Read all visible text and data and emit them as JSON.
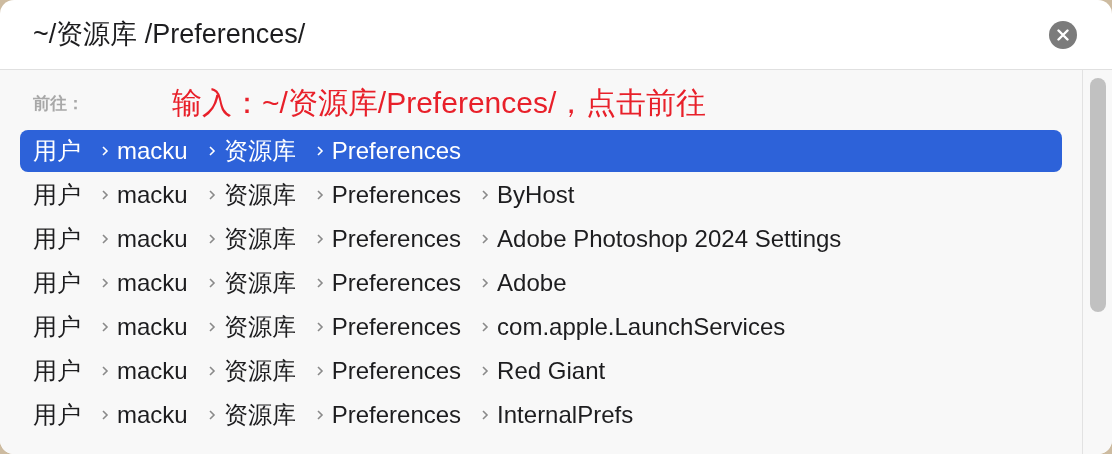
{
  "path_field": {
    "value": "~/资源库 /Preferences/"
  },
  "go_label": "前往：",
  "annotation": "输入：~/资源库/Preferences/，点击前往",
  "rows": [
    {
      "segments": [
        "用户",
        "macku",
        "资源库",
        "Preferences"
      ],
      "selected": true
    },
    {
      "segments": [
        "用户",
        "macku",
        "资源库",
        "Preferences",
        "ByHost"
      ],
      "selected": false
    },
    {
      "segments": [
        "用户",
        "macku",
        "资源库",
        "Preferences",
        "Adobe Photoshop 2024 Settings"
      ],
      "selected": false
    },
    {
      "segments": [
        "用户",
        "macku",
        "资源库",
        "Preferences",
        "Adobe"
      ],
      "selected": false
    },
    {
      "segments": [
        "用户",
        "macku",
        "资源库",
        "Preferences",
        "com.apple.LaunchServices"
      ],
      "selected": false
    },
    {
      "segments": [
        "用户",
        "macku",
        "资源库",
        "Preferences",
        "Red Giant"
      ],
      "selected": false
    },
    {
      "segments": [
        "用户",
        "macku",
        "资源库",
        "Preferences",
        "InternalPrefs"
      ],
      "selected": false
    }
  ]
}
